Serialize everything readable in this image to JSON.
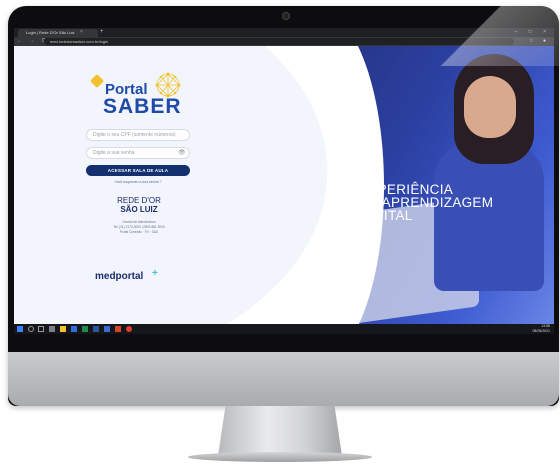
{
  "browser": {
    "tab_title": "Login | Rede D'Or São Luiz",
    "tab_close": "×",
    "new_tab": "+",
    "window_controls": "– □ ×",
    "nav_buttons": "← → C",
    "url": "med.rededorsaoluiz.com.br/login",
    "extensions": "☆ ●"
  },
  "logo": {
    "portal": "Portal",
    "saber": "SABER"
  },
  "login": {
    "cpf_placeholder": "Digite o seu CPF (somente números)",
    "password_placeholder": "Digite a sua senha",
    "eye_icon": "👁",
    "access_button": "ACESSAR SALA DE AULA",
    "forgot_password": "Você esqueceu a sua senha ?"
  },
  "brand": {
    "rede": "REDE D'OR",
    "sao_luiz": "SÃO LUIZ",
    "contact_line1": "Central de Atendimento",
    "contact_line2": "Tel: (21) 2173-3000 | 0800 881 3000",
    "contact_line3": "Portal Conexão · TH · SAD"
  },
  "medportal": {
    "name": "medportal",
    "plus": "+"
  },
  "hero": {
    "line1": "EXPERIÊNCIA",
    "line2": "DE APRENDIZAGEM",
    "line3": "DIGITAL"
  },
  "taskbar": {
    "time": "13:58",
    "date": "08/05/2021"
  },
  "colors": {
    "primary": "#14306e",
    "brand_blue": "#1f4aa8",
    "hero_blue": "#2b3fa0",
    "accent_yellow": "#f2c230",
    "accent_cyan": "#3fc1e0"
  }
}
